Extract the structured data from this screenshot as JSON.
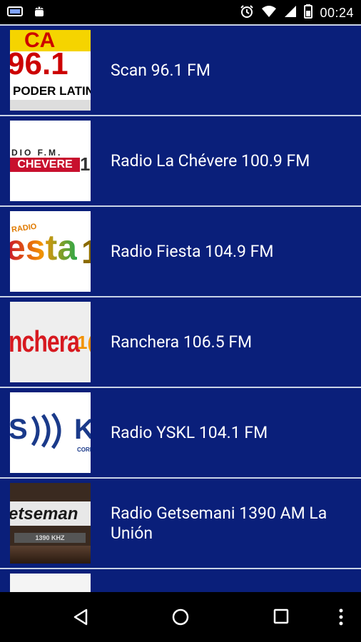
{
  "status_bar": {
    "time": "00:24",
    "left_icons": [
      "notification-icon",
      "android-icon"
    ],
    "right_icons": [
      "alarm-icon",
      "wifi-icon",
      "signal-icon",
      "battery-icon"
    ]
  },
  "stations": [
    {
      "name": "Scan 96.1 FM",
      "logo": {
        "top": "CA",
        "big": "96.1",
        "bottom": "PODER LATIN"
      }
    },
    {
      "name": "Radio La Chévere 100.9 FM",
      "logo": {
        "top": "DIO F.M.",
        "big": "CHEVERE",
        "side": "1C"
      }
    },
    {
      "name": "Radio Fiesta 104.9 FM",
      "logo": {
        "top": "RADIO",
        "big": "esta",
        "side": "1"
      }
    },
    {
      "name": "Ranchera 106.5 FM",
      "logo": {
        "big": "nchera",
        "side": "1("
      }
    },
    {
      "name": "Radio YSKL 104.1 FM",
      "logo": {
        "big": "S",
        "side": "K",
        "bottom": "CORPO"
      }
    },
    {
      "name": "Radio Getsemani 1390 AM La Unión",
      "logo": {
        "big": "etseman",
        "bottom": "1390 KHZ"
      }
    },
    {
      "name": "",
      "logo": {}
    }
  ],
  "colors": {
    "list_background": "#0a1f7a",
    "divider": "#c9d3e6",
    "text": "#ffffff"
  },
  "nav_bar": {
    "buttons": [
      "back-icon",
      "home-icon",
      "recents-icon",
      "menu-icon"
    ]
  }
}
